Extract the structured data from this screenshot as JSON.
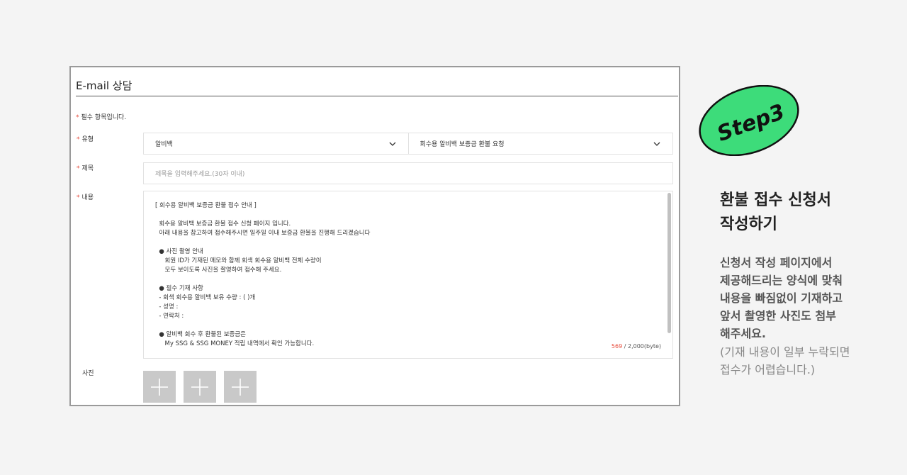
{
  "form": {
    "title": "E-mail 상담",
    "required_note": "필수 항목입니다.",
    "labels": {
      "type": "유형",
      "subject": "제목",
      "content": "내용",
      "photo": "사진"
    },
    "type_select": {
      "primary_value": "알비백",
      "secondary_value": "회수용 알비백 보증금 환불 요청"
    },
    "subject_placeholder": "제목을 입력해주세요.(30자 이내)",
    "content_text": "[ 회수용 알비백 보증금 환불 접수 안내 ]\n\n  회수용 알비백 보증금 환불 접수 신청 페이지 입니다.\n  아래 내용을 참고하여 접수해주시면 일주일 이내 보증금 환불을 진행해 드리겠습니다\n\n  ● 사진 촬영 안내\n     회원 ID가 기재된 메모와 함께 회색 회수용 알비백 전체 수량이\n     모두 보이도록 사진을 촬영하여 접수해 주세요.\n\n  ● 필수 기재 사항\n  - 회색 회수용 알비백 보유 수량 : ( )개\n  - 성명 :\n  - 연락처 :\n\n  ● 알비백 회수 후 환불된 보증금은\n     My SSG & SSG MONEY 적립 내역에서 확인 가능합니다.",
    "byte_current": "569",
    "byte_max": " / 2,000(byte)"
  },
  "side": {
    "badge_text": "Step3",
    "heading_line1": "환불 접수 신청서",
    "heading_line2": "작성하기",
    "desc_lines": [
      "신청서 작성 페이지에서",
      "제공해드리는 양식에 맞춰",
      "내용을 빠짐없이 기재하고",
      "앞서 촬영한 사진도 첨부",
      "해주세요."
    ],
    "note_lines": [
      "(기재 내용이 일부 누락되면",
      "접수가 어렵습니다.)"
    ]
  },
  "colors": {
    "badge_green": "#3ddc7a",
    "required_star": "#e74c3c",
    "photo_tile": "#c9c9c9"
  },
  "icons": [
    "chevron-down-icon",
    "plus-icon"
  ]
}
